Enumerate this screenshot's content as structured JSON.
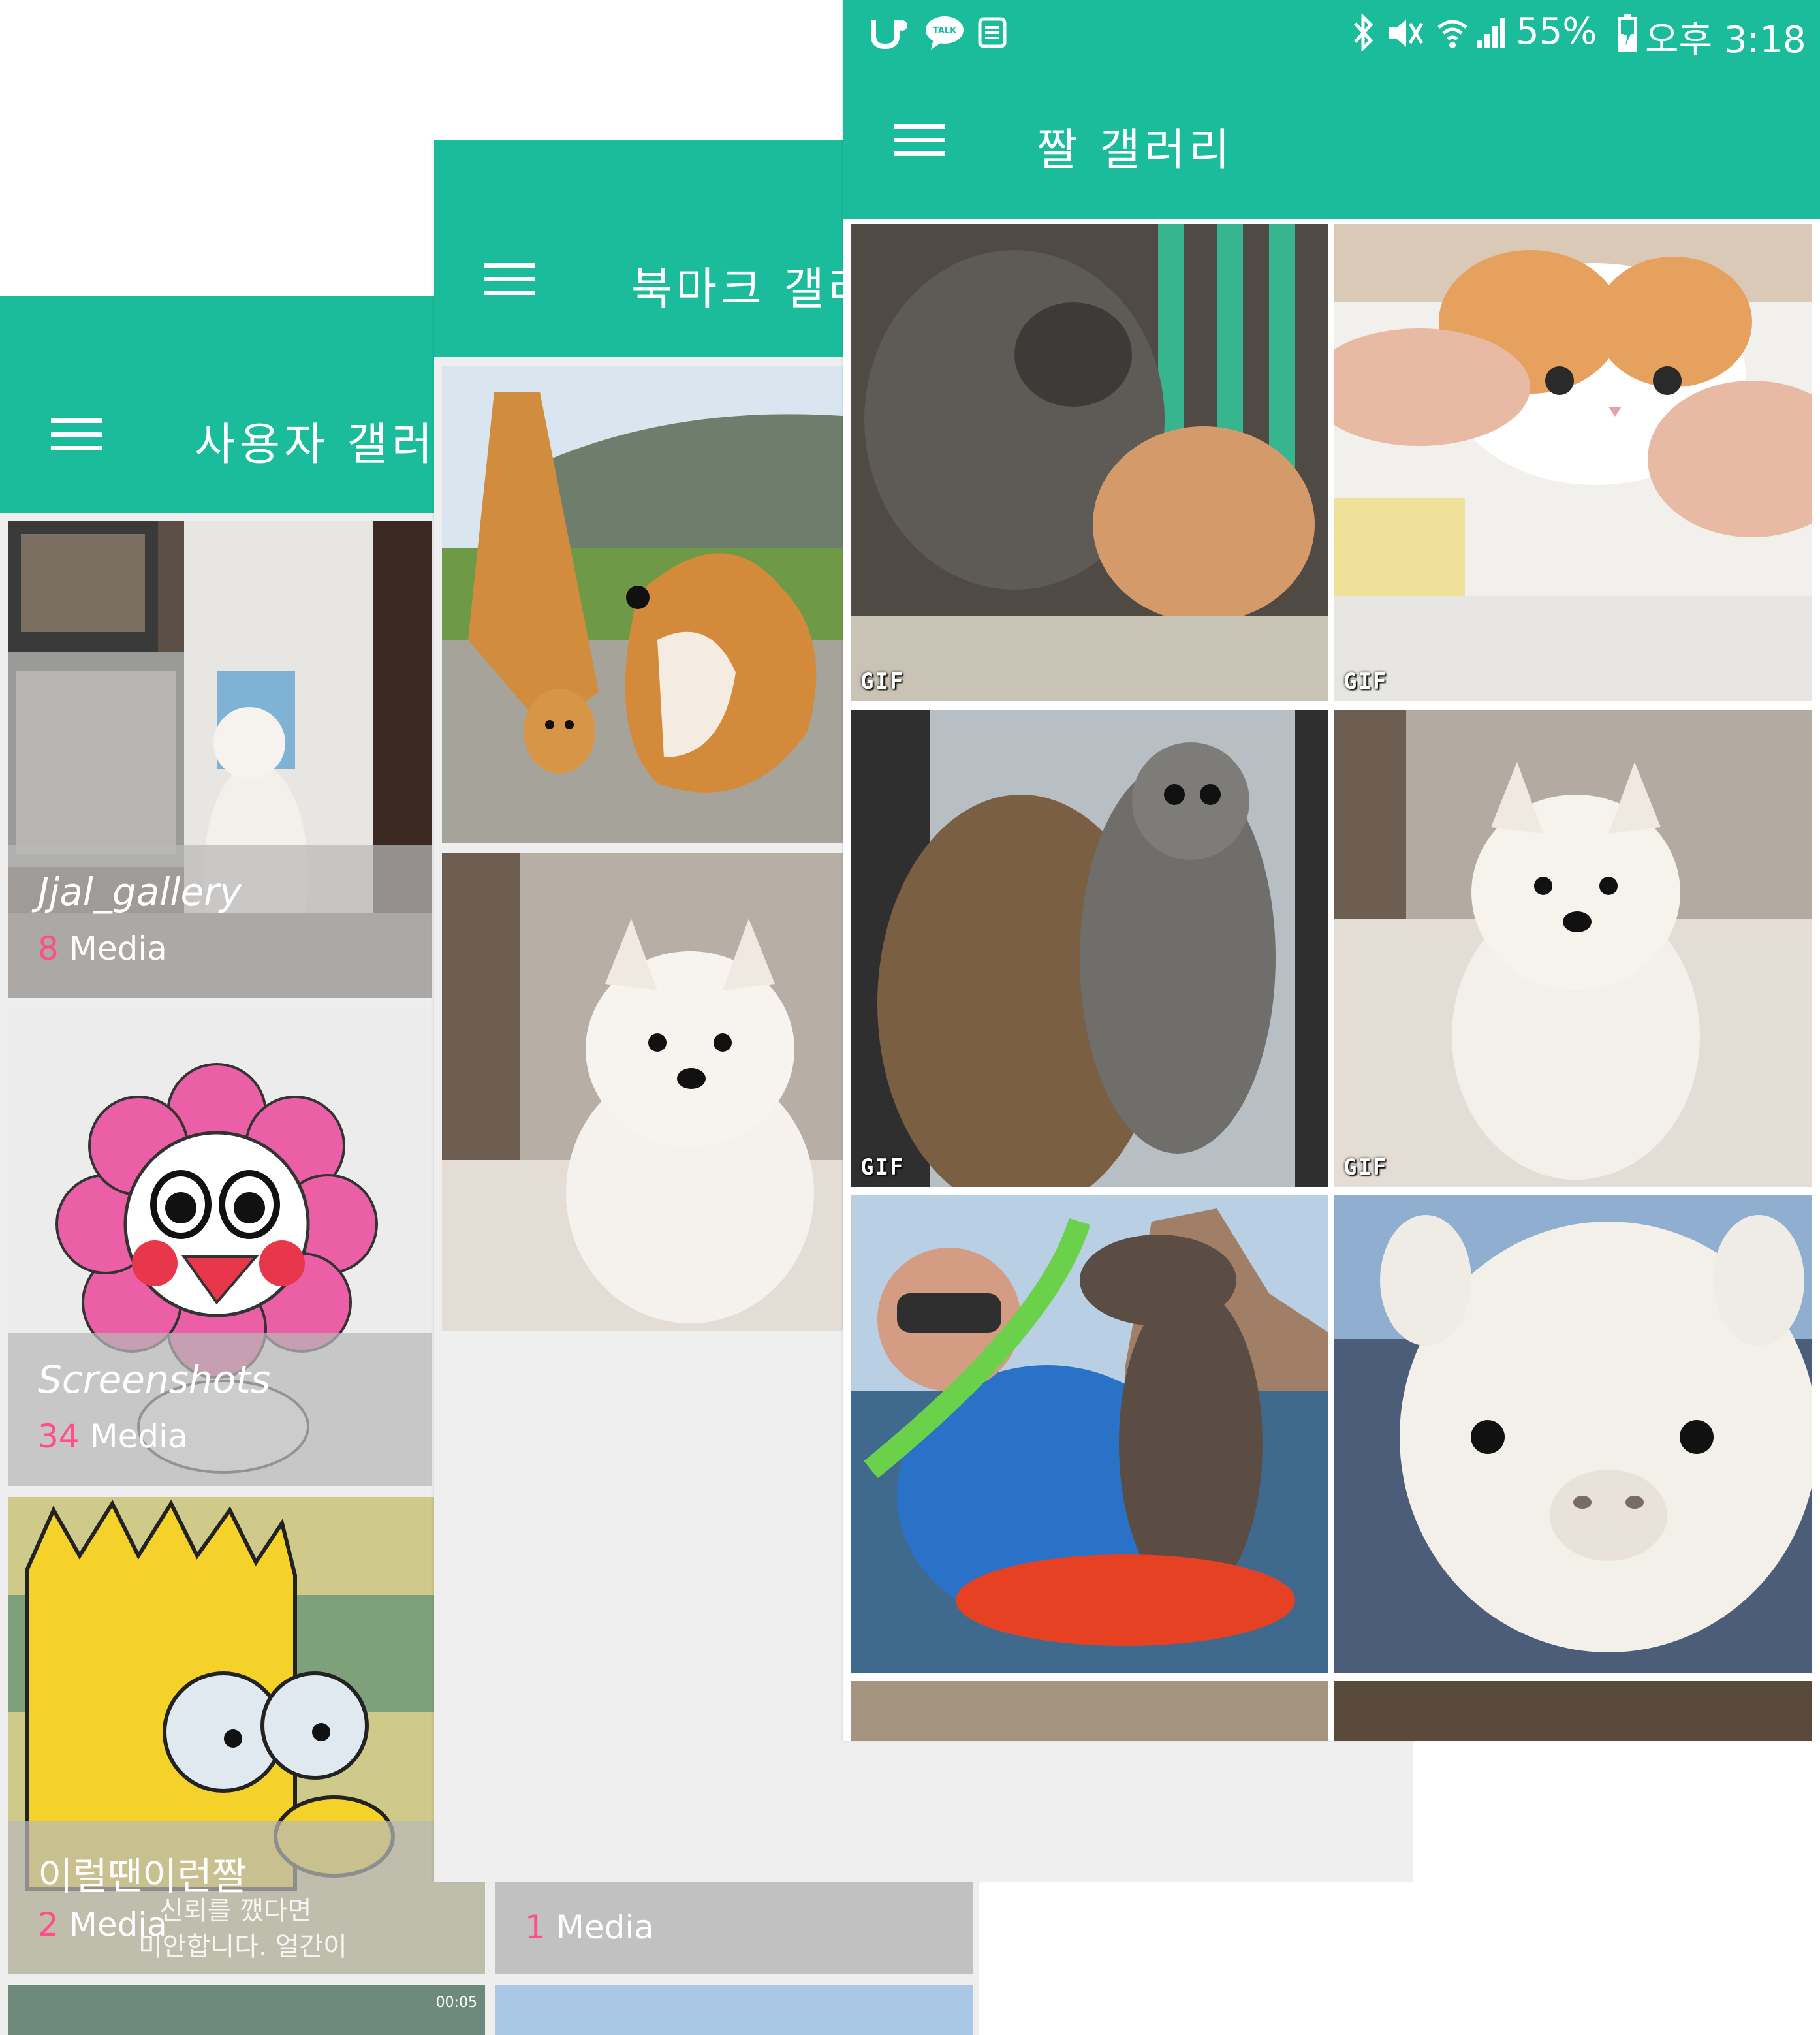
{
  "colors": {
    "accent": "#1abc9c",
    "count_highlight": "#ff4f86",
    "screen_bg": "#eeeeee"
  },
  "status_bar": {
    "battery": "55%",
    "time": "오후 3:18",
    "left_icons": [
      "u-plus-icon",
      "kakaotalk-icon",
      "message-icon"
    ],
    "right_icons": [
      "bluetooth-icon",
      "mute-icon",
      "wifi-icon",
      "signal-icon",
      "battery-charging-icon"
    ],
    "talk_label": "TALK"
  },
  "screens": {
    "user_gallery": {
      "title": "사용자 갤러리",
      "albums": [
        {
          "name": "Jjal_gallery",
          "count": "8",
          "unit": "Media"
        },
        {
          "name": "Screenshots",
          "count": "34",
          "unit": "Media"
        },
        {
          "name": "이럴땐이런짤",
          "count": "2",
          "unit": "Media",
          "caption_lines": [
            "신뢰를 깼다면",
            "미안합니다. 얼간이"
          ]
        },
        {
          "name": "",
          "count": "1",
          "unit": "Media"
        }
      ],
      "video_time": "00:05"
    },
    "bookmark_gallery": {
      "title": "북마크 갤러리",
      "images": [
        "shiba-high-five",
        "white-pomeranian"
      ]
    },
    "jjal_gallery": {
      "title": "짤 갤러리",
      "gif_label": "GIF",
      "images": [
        {
          "subject": "raccoon-and-cat",
          "is_gif": true
        },
        {
          "subject": "cat-face-squeeze",
          "is_gif": true
        },
        {
          "subject": "cats-at-window",
          "is_gif": true
        },
        {
          "subject": "white-pomeranian",
          "is_gif": true
        },
        {
          "subject": "seal-and-snorkeler",
          "is_gif": false
        },
        {
          "subject": "alpaca",
          "is_gif": false
        },
        {
          "subject": "partial-row-left",
          "is_gif": false
        },
        {
          "subject": "partial-row-right",
          "is_gif": false
        }
      ]
    }
  }
}
